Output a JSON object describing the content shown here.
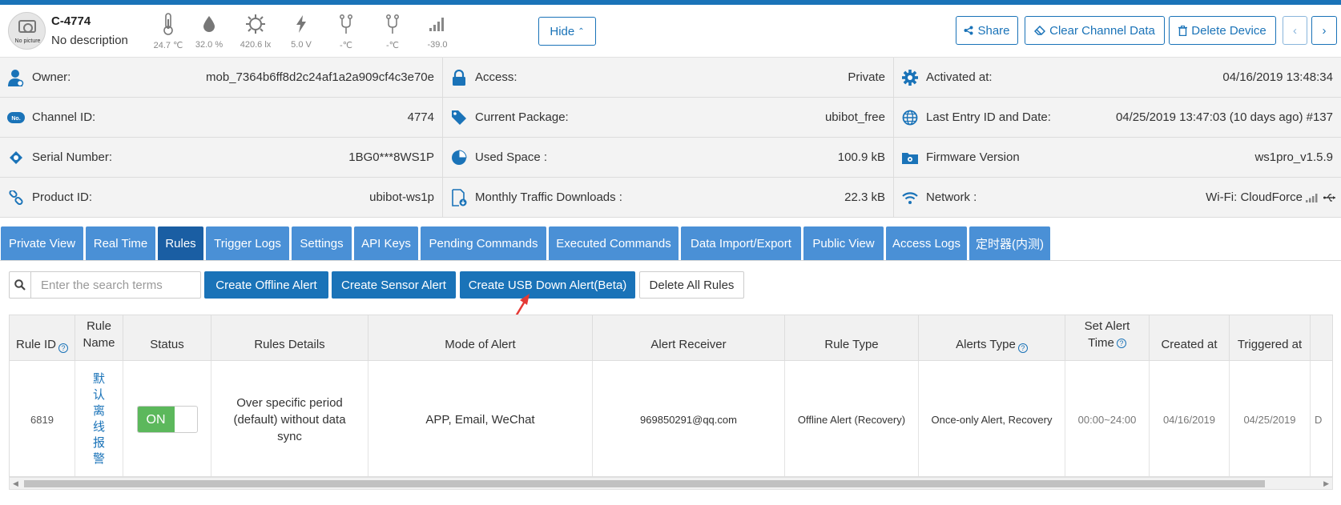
{
  "device": {
    "name": "C-4774",
    "description": "No description",
    "avatar_text": "No picture"
  },
  "sensors": [
    {
      "icon": "thermometer-icon",
      "value": "24.7 ℃"
    },
    {
      "icon": "humidity-drop-icon",
      "value": "32.0 %"
    },
    {
      "icon": "light-sun-icon",
      "value": "420.6 lx"
    },
    {
      "icon": "voltage-bolt-icon",
      "value": "5.0 V"
    },
    {
      "icon": "probe-icon",
      "value": "-℃"
    },
    {
      "icon": "probe-icon",
      "value": "-℃"
    },
    {
      "icon": "signal-bars-icon",
      "value": "-39.0"
    }
  ],
  "header_buttons": {
    "hide": "Hide",
    "share": "Share",
    "clear": "Clear Channel Data",
    "delete": "Delete Device"
  },
  "info": {
    "owner": {
      "label": "Owner:",
      "value": "mob_7364b6ff8d2c24af1a2a909cf4c3e70e"
    },
    "channel_id": {
      "label": "Channel ID:",
      "value": "4774"
    },
    "serial": {
      "label": "Serial Number:",
      "value": "1BG0***8WS1P"
    },
    "product": {
      "label": "Product ID:",
      "value": "ubibot-ws1p"
    },
    "access": {
      "label": "Access:",
      "value": "Private"
    },
    "package": {
      "label": "Current Package:",
      "value": "ubibot_free"
    },
    "used_space": {
      "label": "Used Space :",
      "value": "100.9 kB"
    },
    "traffic": {
      "label": "Monthly Traffic Downloads :",
      "value": "22.3 kB"
    },
    "activated": {
      "label": "Activated at:",
      "value": "04/16/2019 13:48:34"
    },
    "last_entry": {
      "label": "Last Entry ID and Date:",
      "value": "04/25/2019 13:47:03 (10 days ago) #137"
    },
    "firmware": {
      "label": "Firmware Version",
      "value": "ws1pro_v1.5.9"
    },
    "network": {
      "label": "Network :",
      "value": "Wi-Fi: CloudForce"
    }
  },
  "tabs": [
    "Private View",
    "Real Time",
    "Rules",
    "Trigger Logs",
    "Settings",
    "API Keys",
    "Pending Commands",
    "Executed Commands",
    "Data Import/Export",
    "Public View",
    "Access Logs",
    "定时器(内测)"
  ],
  "active_tab": "Rules",
  "toolbar": {
    "search_placeholder": "Enter the search terms",
    "offline_alert": "Create Offline Alert",
    "sensor_alert": "Create Sensor Alert",
    "usb_alert": "Create USB Down Alert(Beta)",
    "delete_all": "Delete All Rules"
  },
  "table": {
    "headers": {
      "rule_id": "Rule ID",
      "rule_name_1": "Rule",
      "rule_name_2": "Name",
      "status": "Status",
      "details": "Rules Details",
      "mode": "Mode of Alert",
      "receiver": "Alert Receiver",
      "rule_type": "Rule Type",
      "alerts_type": "Alerts Type",
      "set_time_1": "Set Alert",
      "set_time_2": "Time",
      "created": "Created at",
      "triggered": "Triggered at"
    },
    "row": {
      "rule_id": "6819",
      "rule_name": "默认离线报警",
      "status": "ON",
      "details": "Over specific period (default) without data sync",
      "mode": "APP, Email, WeChat",
      "receiver": "969850291@qq.com",
      "rule_type": "Offline Alert (Recovery)",
      "alerts_type": "Once-only Alert, Recovery",
      "set_time": "00:00~24:00",
      "created": "04/16/2019",
      "triggered": "04/25/2019",
      "extra": "D"
    }
  },
  "colors": {
    "primary": "#1a73b8",
    "tab": "#4a90d6",
    "tab_active": "#1a5ea3",
    "on": "#5cb85c",
    "annotation_arrow": "#e53935"
  }
}
